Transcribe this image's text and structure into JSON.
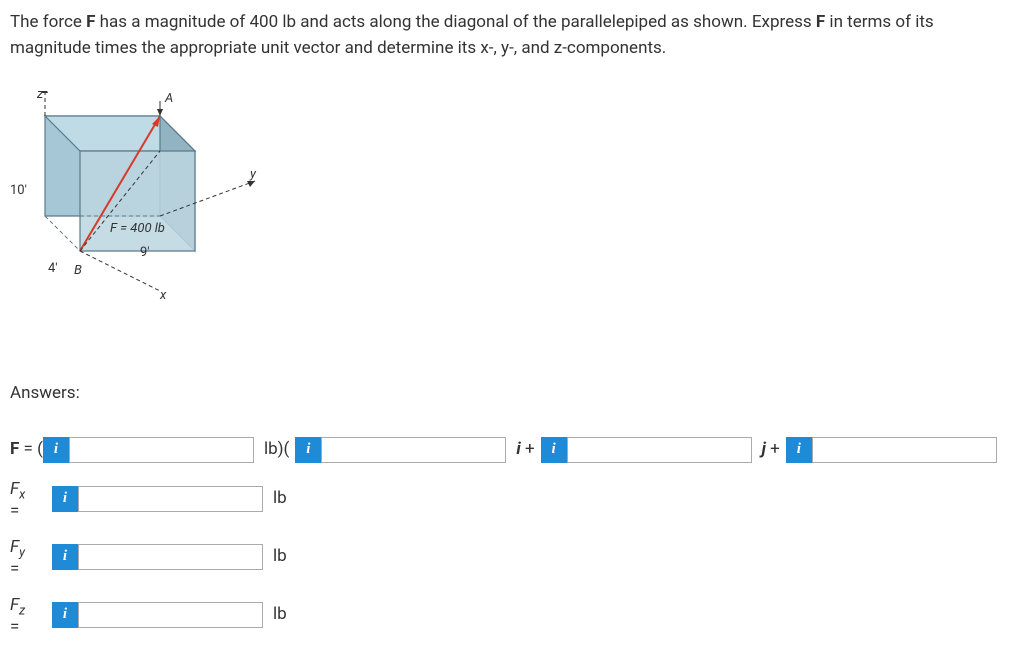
{
  "problem": {
    "line1_a": "The force ",
    "F": "F",
    "line1_b": " has a magnitude of 400 lb and acts along the diagonal of the parallelepiped as shown. Express ",
    "line1_c": " in terms of its",
    "line2": "magnitude times the appropriate unit vector and determine its x-, y-, and z-components."
  },
  "diagram": {
    "z_axis": "z",
    "y_axis": "y",
    "x_axis": "x",
    "point_A": "A",
    "point_B": "B",
    "height": "10'",
    "depth": "4'",
    "width": "9'",
    "force": "F = 400 lb"
  },
  "answers_heading": "Answers:",
  "row1": {
    "prefix": "F",
    "eq": " = ( ",
    "info": "i",
    "mid1": "lb)( ",
    "mid2": "i + ",
    "mid3": "j + ",
    "end": ""
  },
  "row2": {
    "label_top": "F",
    "label_sub": "x",
    "eq": "=",
    "info": "i",
    "unit": "lb"
  },
  "row3": {
    "label_top": "F",
    "label_sub": "y",
    "eq": "=",
    "info": "i",
    "unit": "lb"
  },
  "row4": {
    "label_top": "F",
    "label_sub": "z",
    "eq": "=",
    "info": "i",
    "unit": "lb"
  }
}
